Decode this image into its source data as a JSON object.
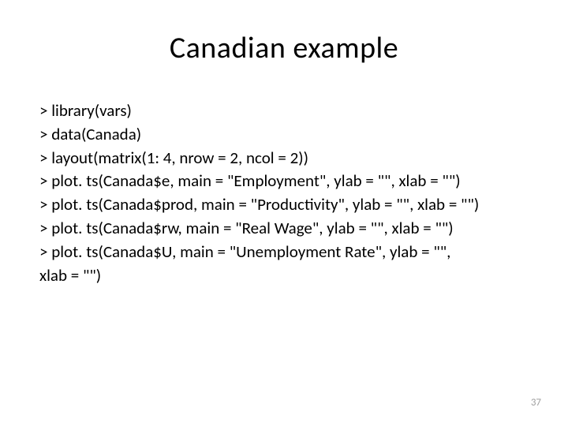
{
  "slide": {
    "title": "Canadian example",
    "code_lines": [
      "> library(vars)",
      "> data(Canada)",
      "> layout(matrix(1: 4, nrow = 2, ncol = 2))",
      "> plot. ts(Canada$e, main = \"Employment\", ylab = \"\", xlab = \"\")",
      "> plot. ts(Canada$prod, main = \"Productivity\", ylab = \"\", xlab = \"\")",
      "> plot. ts(Canada$rw, main = \"Real Wage\", ylab = \"\", xlab = \"\")",
      "> plot. ts(Canada$U, main = \"Unemployment Rate\", ylab = \"\",",
      "xlab = \"\")"
    ],
    "page_number": "37"
  }
}
